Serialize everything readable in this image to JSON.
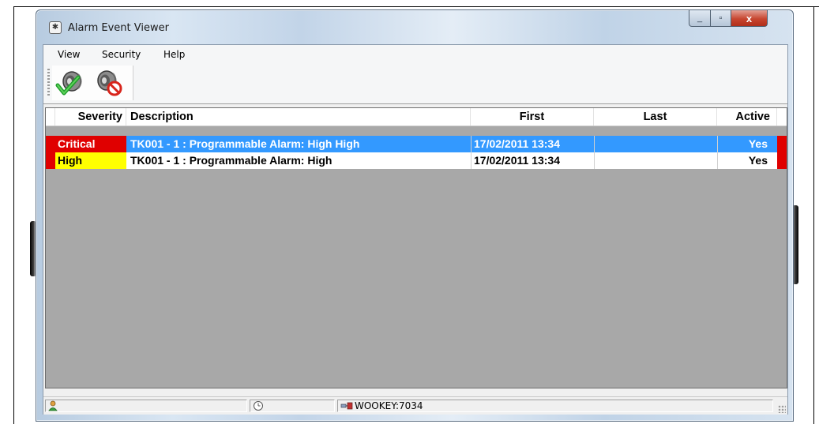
{
  "window": {
    "title": "Alarm Event Viewer",
    "close_glyph": "x",
    "max_glyph": "▫",
    "min_glyph": "_"
  },
  "menu": {
    "view": "View",
    "security": "Security",
    "help": "Help"
  },
  "toolbar": {
    "icons": [
      "speaker-check-icon",
      "speaker-mute-icon"
    ]
  },
  "columns": {
    "severity": "Severity",
    "description": "Description",
    "first": "First",
    "last": "Last",
    "active": "Active"
  },
  "alarms": [
    {
      "severity": "Critical",
      "severity_color": "#e00000",
      "description": "TK001 - 1 : Programmable Alarm: High High",
      "first": "17/02/2011 13:34",
      "last": "",
      "active": "Yes",
      "selected": true
    },
    {
      "severity": "High",
      "severity_color": "#ffff00",
      "description": "TK001 - 1 : Programmable Alarm: High",
      "first": "17/02/2011 13:34",
      "last": "",
      "active": "Yes",
      "selected": false
    }
  ],
  "status": {
    "connection": "WOOKEY:7034"
  },
  "colors": {
    "selection": "#3399ff",
    "list_background": "#a8a8a8",
    "alarm_strip": "#e00000"
  }
}
